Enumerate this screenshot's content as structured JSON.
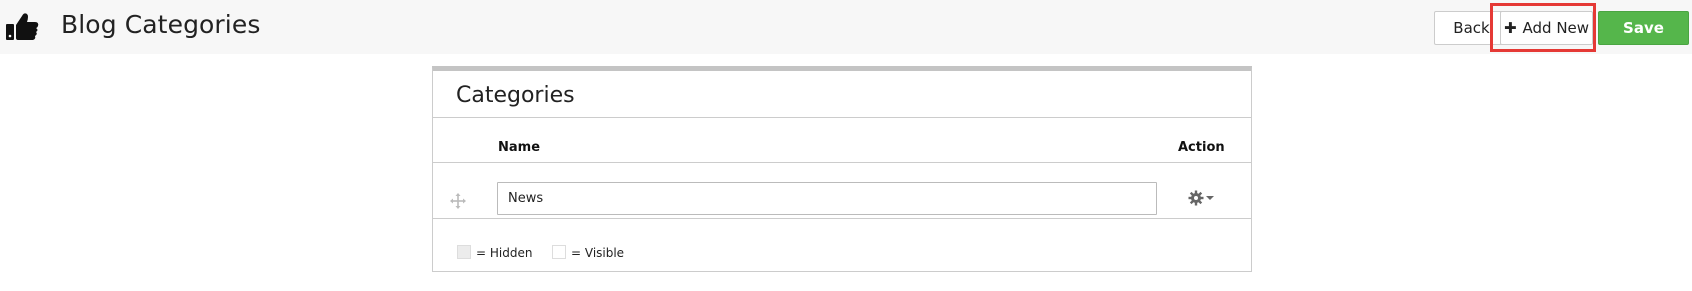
{
  "header": {
    "icon": "thumbs-up-icon",
    "title": "Blog Categories",
    "back_label": "Back",
    "add_new_label": "Add New",
    "save_label": "Save"
  },
  "panel": {
    "title": "Categories",
    "columns": {
      "name": "Name",
      "action": "Action"
    },
    "rows": [
      {
        "name_value": "News",
        "drag_icon": "move-icon",
        "action_icon": "gear-icon"
      }
    ],
    "legend": {
      "hidden_label": "= Hidden",
      "visible_label": "= Visible"
    }
  },
  "colors": {
    "save_button": "#55b64b",
    "highlight": "#e53935",
    "header_bg": "#f7f7f7"
  }
}
